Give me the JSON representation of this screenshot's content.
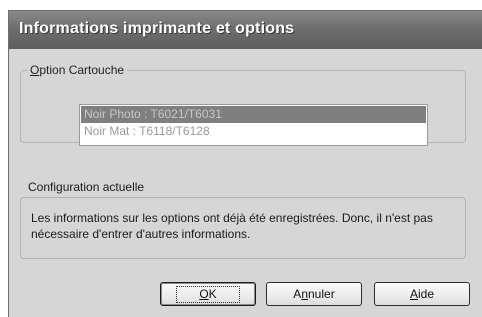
{
  "dialog": {
    "title": "Informations imprimante et options"
  },
  "cartouche": {
    "legend_prefix": "",
    "legend_underlined": "O",
    "legend_rest": "ption Cartouche",
    "items": [
      {
        "label": "Noir Photo : T6021/T6031",
        "selected": true
      },
      {
        "label": "Noir Mat : T6118/T6128",
        "selected": false
      }
    ]
  },
  "config": {
    "label": "Configuration actuelle",
    "message": "Les informations sur les options ont déjà été enregistrées. Donc, il n'est pas nécessaire d'entrer d'autres informations."
  },
  "buttons": {
    "ok": {
      "underlined": "O",
      "rest": "K"
    },
    "annuler": {
      "prefix": "A",
      "underlined": "n",
      "rest": "nuler"
    },
    "aide": {
      "underlined": "A",
      "rest": "ide"
    }
  }
}
